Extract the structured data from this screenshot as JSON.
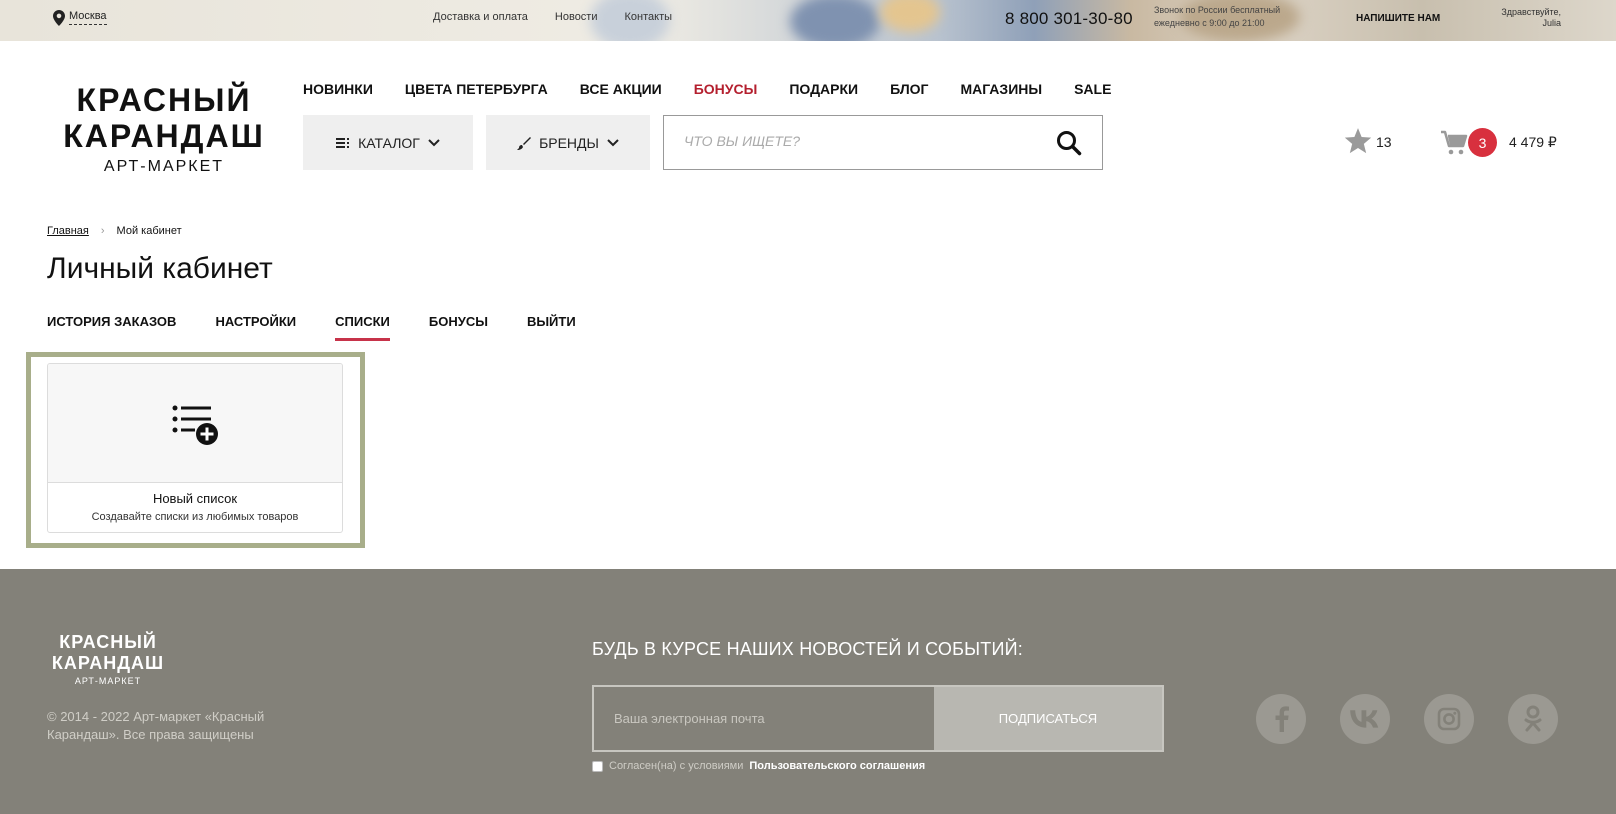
{
  "topbar": {
    "city": "Москва",
    "links": [
      "Доставка и оплата",
      "Новости",
      "Контакты"
    ],
    "phone": "8 800 301-30-80",
    "phone_note_1": "Звонок по России бесплатный",
    "phone_note_2": "ежедневно с 9:00 до 21:00",
    "write_us": "НАПИШИТЕ НАМ",
    "greeting": "Здравствуйте,",
    "user": "Julia"
  },
  "logo": {
    "line1": "КРАСНЫЙ",
    "line2": "КАРАНДАШ",
    "line3": "АРТ-МАРКЕТ"
  },
  "nav": [
    "НОВИНКИ",
    "ЦВЕТА ПЕТЕРБУРГА",
    "ВСЕ АКЦИИ",
    "БОНУСЫ",
    "ПОДАРКИ",
    "БЛОГ",
    "МАГАЗИНЫ",
    "SALE"
  ],
  "nav_accent_color": "#b41f2e",
  "catalog_label": "КАТАЛОГ",
  "brands_label": "БРЕНДЫ",
  "search": {
    "placeholder": "ЧТО ВЫ ИЩЕТЕ?"
  },
  "favorites_count": "13",
  "cart": {
    "count": "3",
    "total": "4 479 ₽",
    "badge_color": "#d8303e"
  },
  "breadcrumb": {
    "home": "Главная",
    "current": "Мой кабинет"
  },
  "page_title": "Личный кабинет",
  "tabs": [
    "ИСТОРИЯ ЗАКАЗОВ",
    "НАСТРОЙКИ",
    "СПИСКИ",
    "БОНУСЫ",
    "ВЫЙТИ"
  ],
  "active_tab": "СПИСКИ",
  "new_list": {
    "title": "Новый список",
    "subtitle": "Создавайте списки из любимых товаров"
  },
  "footer": {
    "logo_line1": "КРАСНЫЙ",
    "logo_line2": "КАРАНДАШ",
    "logo_line3": "АРТ-МАРКЕТ",
    "copyright": "© 2014 - 2022 Арт-маркет «Красный Карандаш». Все права защищены",
    "news_title": "БУДЬ В КУРСЕ НАШИХ НОВОСТЕЙ И СОБЫТИЙ:",
    "email_placeholder": "Ваша электронная почта",
    "subscribe": "ПОДПИСАТЬСЯ",
    "agree_text": "Согласен(на) с условиями",
    "agree_link": "Пользовательского соглашения",
    "socials": [
      "facebook-icon",
      "vk-icon",
      "instagram-icon",
      "odnoklassniki-icon"
    ]
  }
}
